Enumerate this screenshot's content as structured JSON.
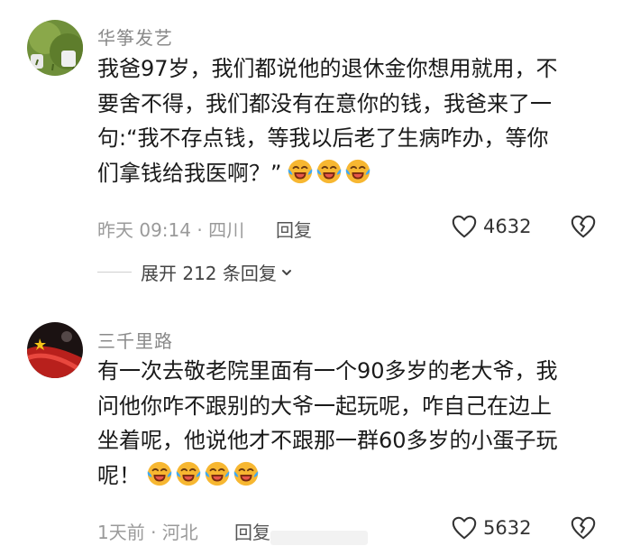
{
  "comments": [
    {
      "username": "华筝发艺",
      "lines": [
        "我爸97岁，我们都说他的退休金你想用就用，不",
        "要舍不得，我们都没有在意你的钱，我爸来了一",
        "句:“我不存点钱，等我以后老了生病咋办，等你",
        "们拿钱给我医啊？”"
      ],
      "emoji": [
        "laughing-tears-emoji",
        "laughing-tears-emoji",
        "laughing-tears-emoji"
      ],
      "meta": "昨天 09:14 · 四川",
      "reply_label": "回复",
      "likes": "4632",
      "expand_label": "展开 212 条回复"
    },
    {
      "username": "三千里路",
      "lines": [
        "有一次去敬老院里面有一个90多岁的老大爷，我",
        "问他你咋不跟别的大爷一起玩呢，咋自己在边上",
        "坐着呢，他说他才不跟那一群60多岁的小蛋子玩",
        "呢！"
      ],
      "emoji": [
        "laughing-tears-emoji",
        "laughing-tears-emoji",
        "laughing-tears-emoji",
        "laughing-tears-emoji"
      ],
      "meta": "1天前 · 河北",
      "reply_label": "回复",
      "likes": "5632"
    }
  ],
  "colors": {
    "username": "#8a8a8a",
    "meta": "#9a9a9a",
    "emoji_face": "#f7b731",
    "emoji_tears": "#3fa9f5"
  }
}
